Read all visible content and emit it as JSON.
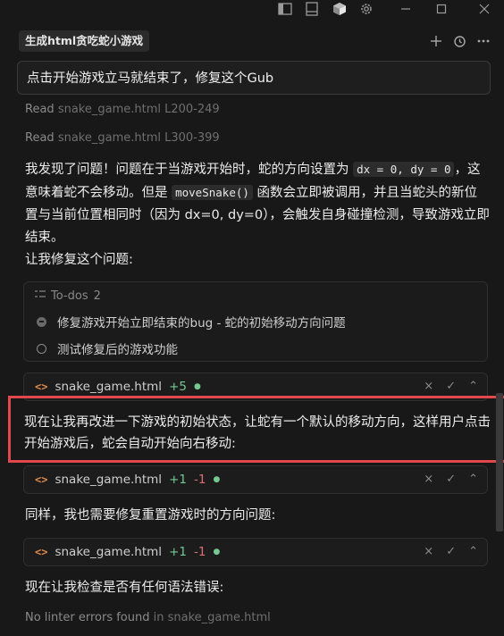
{
  "header": {
    "chat_title": "生成html贪吃蛇小游戏"
  },
  "user_message": "点击开始游戏立马就结束了，修复这个Gub",
  "reads": [
    {
      "verb": "Read",
      "file": "snake_game.html",
      "range": "L200-249"
    },
    {
      "verb": "Read",
      "file": "snake_game.html",
      "range": "L300-399"
    }
  ],
  "explanation": {
    "text1": "我发现了问题！问题在于当游戏开始时，蛇的方向设置为",
    "code1": "dx = 0, dy = 0",
    "text2": "，这意味着蛇不会移动。但是",
    "code2": "moveSnake()",
    "text3": "函数会立即被调用，并且当蛇头的新位置与当前位置相同时（因为 dx=0, dy=0），会触发自身碰撞检测，导致游戏立即结束。"
  },
  "fix_intro": "让我修复这个问题:",
  "todos": {
    "label": "To-dos",
    "count": "2",
    "items": [
      {
        "text": "修复游戏开始立即结束的bug - 蛇的初始移动方向问题",
        "status": "in-progress"
      },
      {
        "text": "测试修复后的游戏功能",
        "status": "pending"
      }
    ]
  },
  "edits": [
    {
      "file": "snake_game.html",
      "added": "+5",
      "removed": ""
    },
    {
      "file": "snake_game.html",
      "added": "+1",
      "removed": "-1"
    },
    {
      "file": "snake_game.html",
      "added": "+1",
      "removed": "-1"
    }
  ],
  "messages": {
    "improve_initial": "现在让我再改进一下游戏的初始状态，让蛇有一个默认的移动方向，这样用户点击开始游戏后，蛇会自动开始向右移动:",
    "reset_fix": "同样，我也需要修复重置游戏时的方向问题:",
    "syntax_check": "现在让我检查是否有任何语法错误:"
  },
  "linter": {
    "text": "No linter errors found",
    "in_label": "in",
    "file": "snake_game.html"
  },
  "icons": {
    "code_glyph": "<>",
    "reject": "×",
    "accept": "✓",
    "expand": "⌃"
  },
  "colors": {
    "highlight_border": "#e0484e",
    "added": "#73c991",
    "removed": "#e06c75",
    "file_icon": "#e08a4a"
  }
}
